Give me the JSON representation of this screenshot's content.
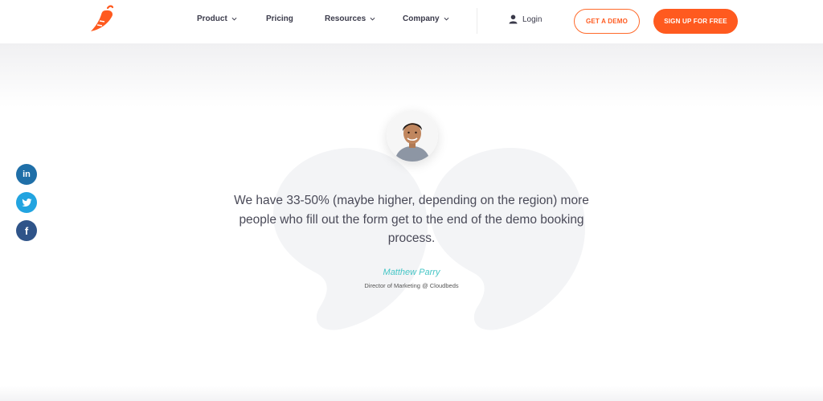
{
  "brand": {
    "accent": "#ff5a1f",
    "teal": "#46c6c6"
  },
  "nav": {
    "items": [
      {
        "label": "Product",
        "dropdown": true
      },
      {
        "label": "Pricing",
        "dropdown": false
      },
      {
        "label": "Resources",
        "dropdown": true
      },
      {
        "label": "Company",
        "dropdown": true
      }
    ],
    "login_label": "Login",
    "demo_label": "GET A DEMO",
    "signup_label": "SIGN UP FOR FREE"
  },
  "social": {
    "linkedin_glyph": "in",
    "facebook_glyph": "f"
  },
  "testimonial": {
    "quote": "We have 33-50% (maybe higher, depending on the region) more people who fill out the form get to the end of the demo booking process.",
    "author": "Matthew Parry",
    "role": "Director of Marketing @ Cloudbeds"
  }
}
